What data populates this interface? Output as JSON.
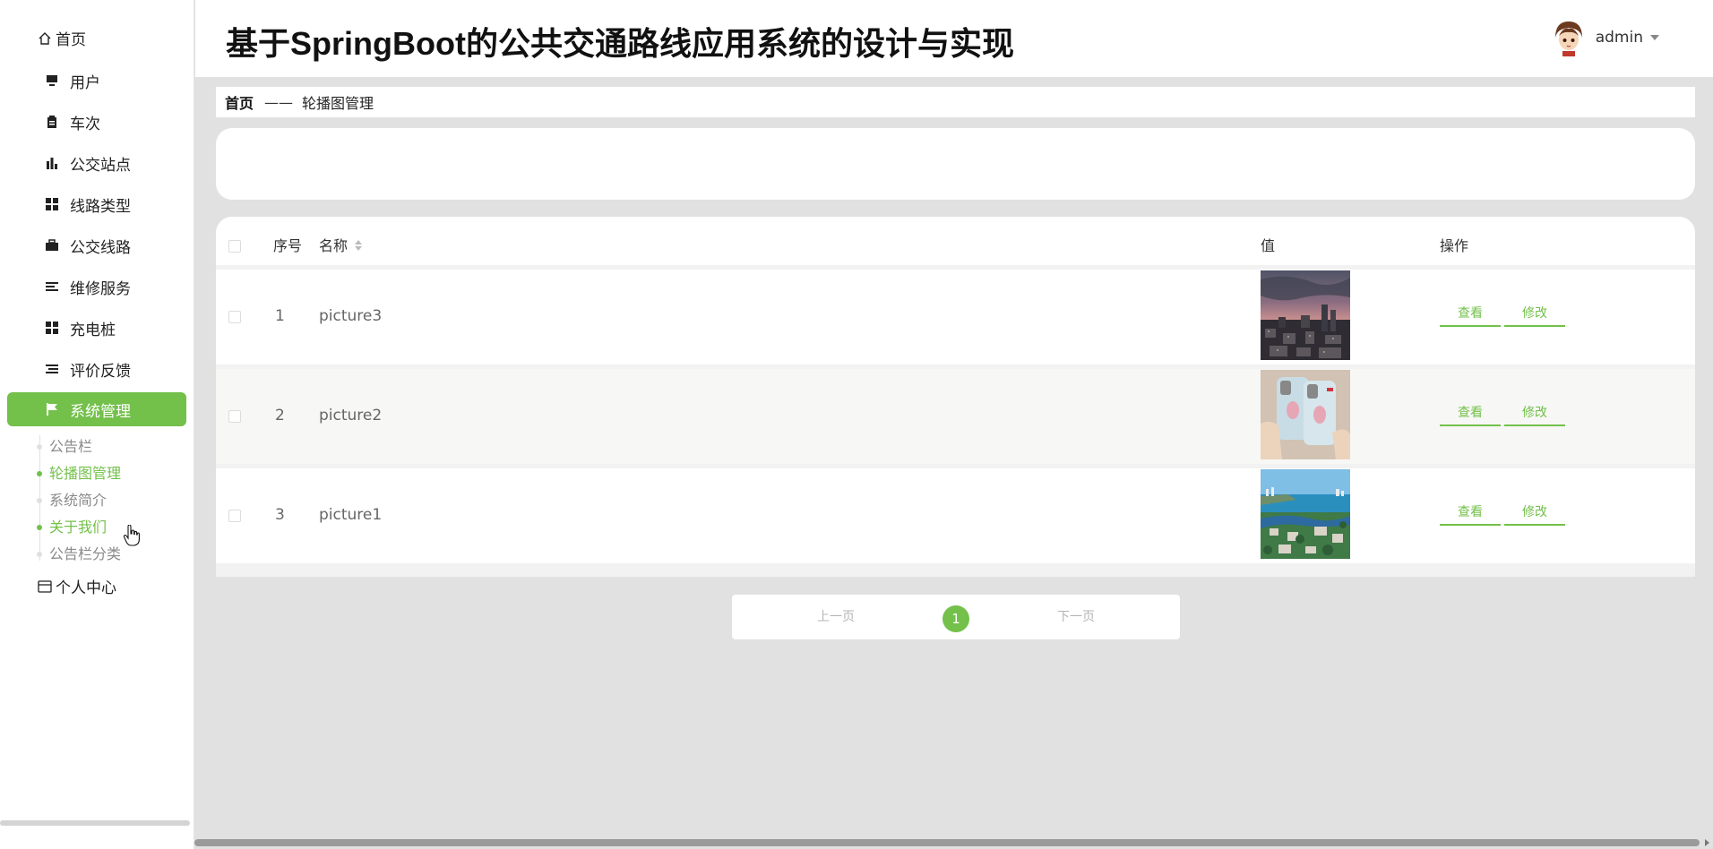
{
  "app_title": "基于SpringBoot的公共交通路线应用系统的设计与实现",
  "user": {
    "name": "admin"
  },
  "sidebar": {
    "home": "首页",
    "items": [
      {
        "label": "用户",
        "icon": "monitor-icon"
      },
      {
        "label": "车次",
        "icon": "clipboard-icon"
      },
      {
        "label": "公交站点",
        "icon": "bar-chart-icon"
      },
      {
        "label": "线路类型",
        "icon": "grid-icon"
      },
      {
        "label": "公交线路",
        "icon": "briefcase-icon"
      },
      {
        "label": "维修服务",
        "icon": "list-icon"
      },
      {
        "label": "充电桩",
        "icon": "grid-icon"
      },
      {
        "label": "评价反馈",
        "icon": "list-indent-icon"
      },
      {
        "label": "系统管理",
        "icon": "flag-icon",
        "active": true
      }
    ],
    "submenu": [
      {
        "label": "公告栏"
      },
      {
        "label": "轮播图管理",
        "current": true
      },
      {
        "label": "系统简介"
      },
      {
        "label": "关于我们",
        "hover": true
      },
      {
        "label": "公告栏分类"
      }
    ],
    "personal": "个人中心"
  },
  "breadcrumb": {
    "home": "首页",
    "separator": "——",
    "current": "轮播图管理"
  },
  "table": {
    "columns": {
      "index": "序号",
      "name": "名称",
      "value": "值",
      "actions": "操作"
    },
    "rows": [
      {
        "index": "1",
        "name": "picture3",
        "image": "city-skyline-dusk"
      },
      {
        "index": "2",
        "name": "picture2",
        "image": "phone-cases"
      },
      {
        "index": "3",
        "name": "picture1",
        "image": "coastal-city"
      }
    ],
    "view_label": "查看",
    "edit_label": "修改"
  },
  "pagination": {
    "prev": "上一页",
    "current": "1",
    "next": "下一页"
  },
  "colors": {
    "accent": "#73c04a",
    "background": "#e1e1e1"
  }
}
